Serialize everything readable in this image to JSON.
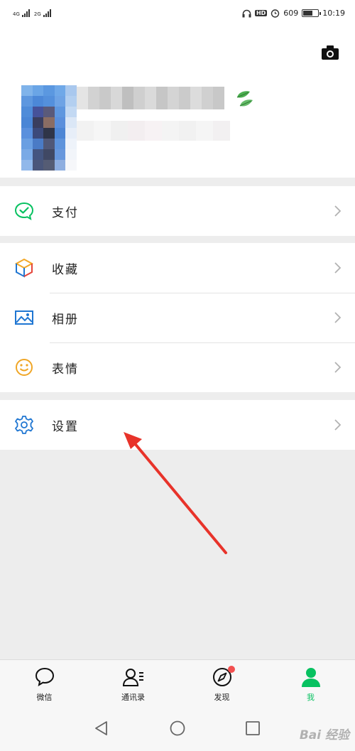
{
  "status_bar": {
    "left": [
      "4G",
      "2G"
    ],
    "hd": "HD",
    "speed": "609",
    "time": "10:19",
    "battery_fraction": 0.6
  },
  "profile": {
    "camera_icon": "camera-icon",
    "leaf_icon": "leaf-icon"
  },
  "menu": {
    "pay": {
      "label": "支付",
      "icon": "wechat-pay-icon",
      "color": "#07c160"
    },
    "favorites": {
      "label": "收藏",
      "icon": "cube-icon"
    },
    "album": {
      "label": "相册",
      "icon": "image-icon",
      "color": "#1f76d2"
    },
    "stickers": {
      "label": "表情",
      "icon": "smile-icon",
      "color": "#f0a626"
    },
    "settings": {
      "label": "设置",
      "icon": "gear-icon",
      "color": "#1f76d2"
    }
  },
  "tabs": [
    {
      "label": "微信",
      "icon": "chat-bubble-icon"
    },
    {
      "label": "通讯录",
      "icon": "contacts-icon"
    },
    {
      "label": "发现",
      "icon": "compass-icon",
      "badge": true
    },
    {
      "label": "我",
      "icon": "person-icon",
      "active": true
    }
  ],
  "system_nav": {
    "back_icon": "triangle-back-icon",
    "home_icon": "circle-home-icon",
    "recents_icon": "square-recents-icon"
  },
  "watermark": "Bai 经验",
  "colors": {
    "accent": "#07c160",
    "arrow": "#e8332a"
  }
}
